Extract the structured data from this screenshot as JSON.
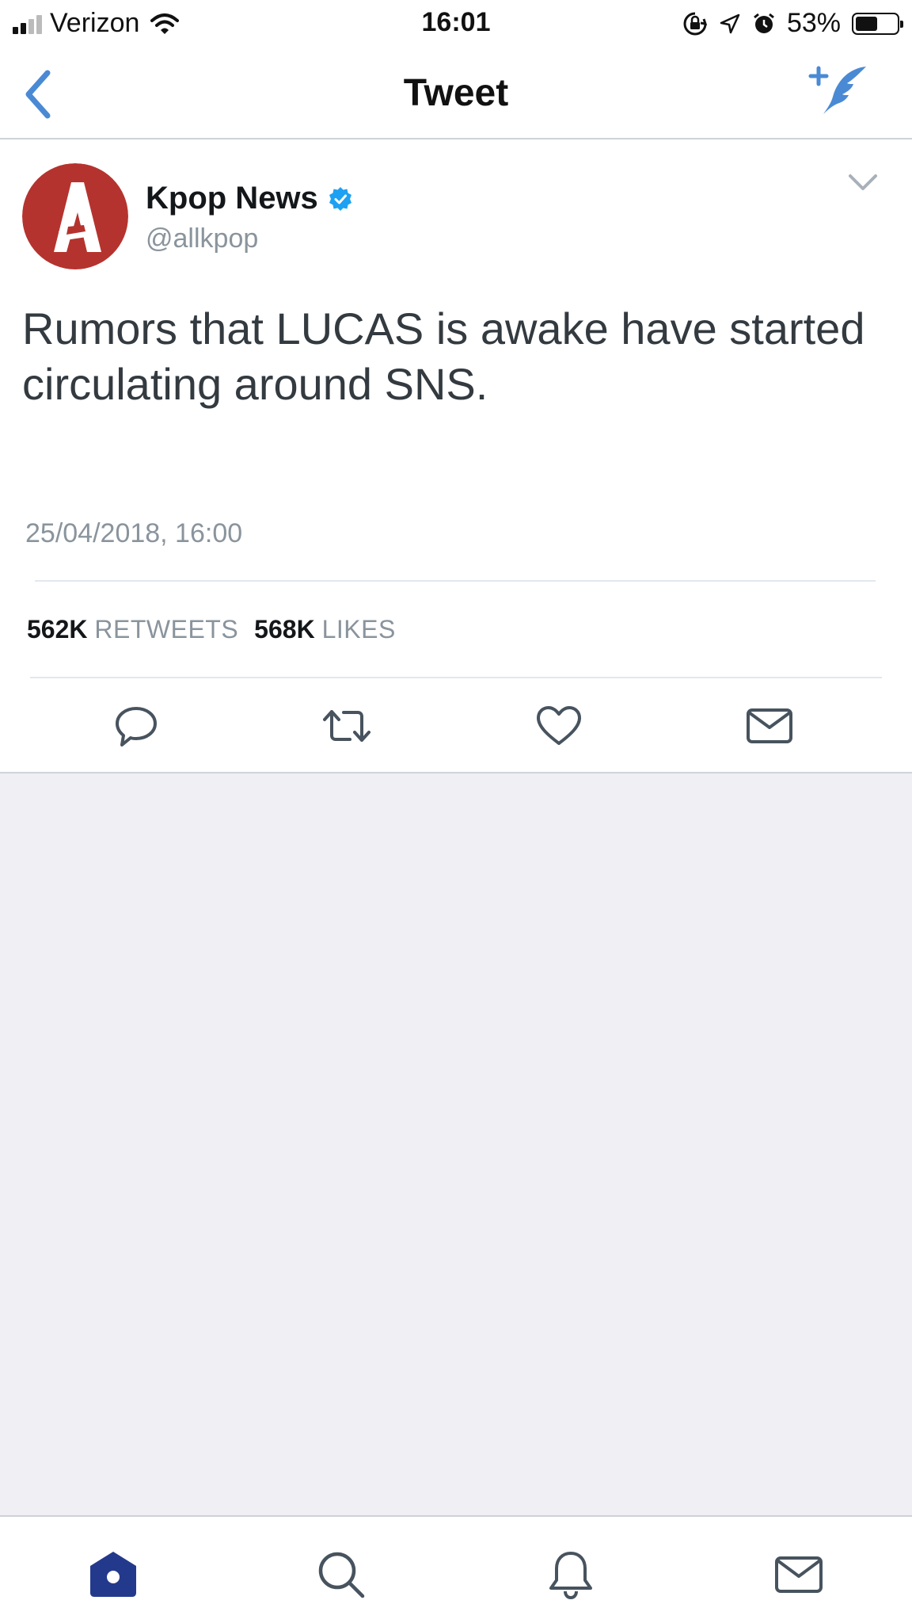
{
  "status_bar": {
    "carrier": "Verizon",
    "time": "16:01",
    "battery_percent": "53%",
    "battery_level": 0.53,
    "icons": [
      "signal-icon",
      "wifi-icon",
      "orientation-lock-icon",
      "location-icon",
      "alarm-icon",
      "battery-icon"
    ]
  },
  "nav": {
    "title": "Tweet",
    "back_icon": "chevron-left-icon",
    "compose_icon": "compose-tweet-icon"
  },
  "tweet": {
    "author_name": "Kpop News",
    "author_handle": "@allkpop",
    "verified": true,
    "text": "Rumors that LUCAS is awake have started circulating around SNS.",
    "timestamp": "25/04/2018, 16:00",
    "retweets_count": "562K",
    "retweets_label": "RETWEETS",
    "likes_count": "568K",
    "likes_label": "LIKES",
    "actions": [
      "reply-icon",
      "retweet-icon",
      "like-icon",
      "direct-message-icon"
    ]
  },
  "tab_bar": {
    "tabs": [
      "home-icon",
      "search-icon",
      "notifications-icon",
      "messages-icon"
    ],
    "active": "home-icon"
  },
  "colors": {
    "accent": "#1da1f2",
    "nav_icon_blue": "#4a8ad4",
    "avatar_red": "#b5332e",
    "text_dark": "#14171a",
    "text_gray": "#8a949d",
    "background_gray": "#efeff4",
    "active_tab": "#233a8c"
  }
}
